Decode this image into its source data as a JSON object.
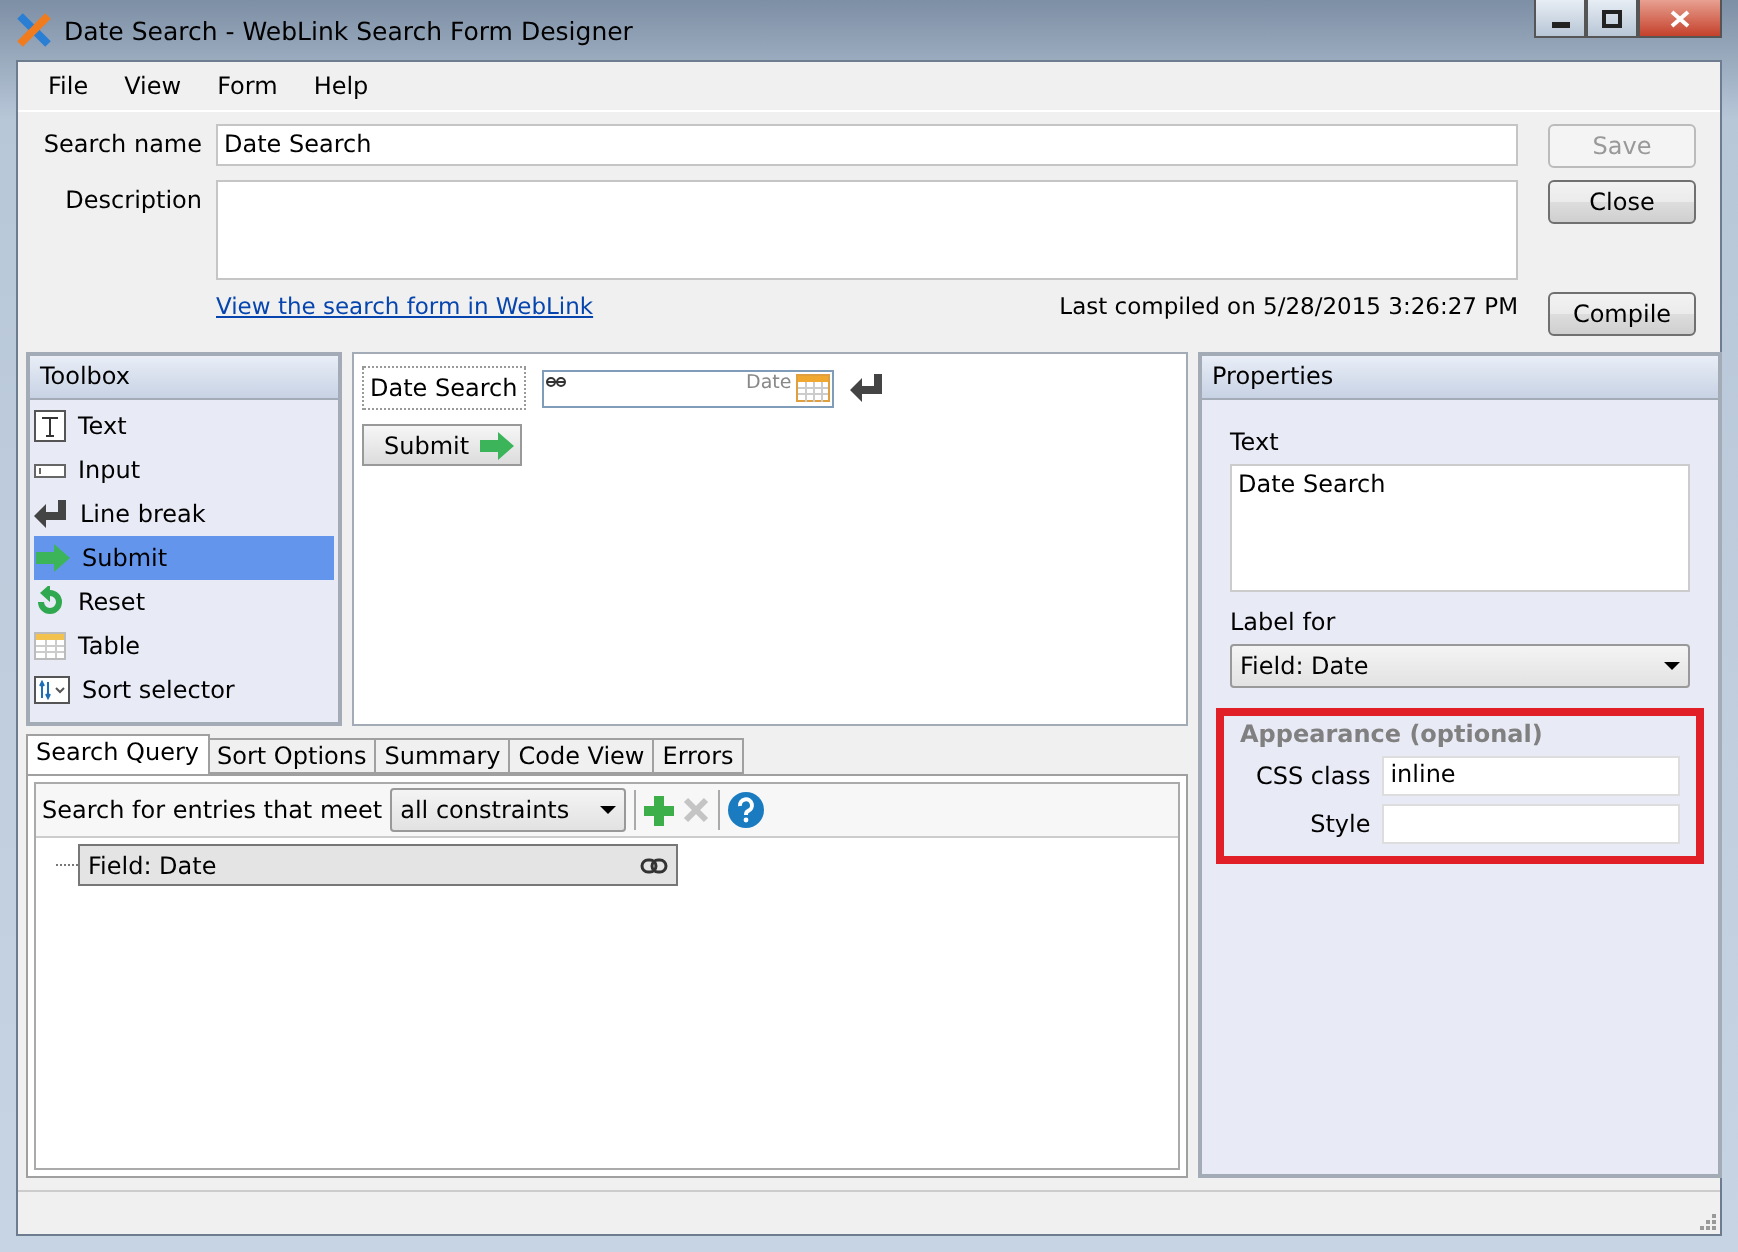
{
  "window": {
    "title": "Date Search - WebLink Search Form Designer"
  },
  "menu": [
    "File",
    "View",
    "Form",
    "Help"
  ],
  "search_name": {
    "label": "Search name",
    "value": "Date Search"
  },
  "description": {
    "label": "Description"
  },
  "link": "View the search form in WebLink",
  "last_compiled": "Last compiled on 5/28/2015 3:26:27 PM",
  "buttons": [
    {
      "label": "Save",
      "disabled": true
    },
    {
      "label": "Close",
      "disabled": false
    },
    {
      "label": "Compile",
      "disabled": false
    }
  ],
  "toolbox": {
    "title": "Toolbox",
    "items": [
      {
        "label": "Text",
        "kind": "text",
        "selected": false
      },
      {
        "label": "Input",
        "kind": "input",
        "selected": false
      },
      {
        "label": "Line break",
        "kind": "linebreak",
        "selected": false
      },
      {
        "label": "Submit",
        "kind": "submit",
        "selected": true
      },
      {
        "label": "Reset",
        "kind": "reset",
        "selected": false
      },
      {
        "label": "Table",
        "kind": "table",
        "selected": false
      },
      {
        "label": "Sort selector",
        "kind": "sort",
        "selected": false
      }
    ]
  },
  "canvas": {
    "label": "Date Search",
    "date_placeholder": "Date",
    "submit": "Submit"
  },
  "tabs": [
    {
      "label": "Search Query",
      "selected": true
    },
    {
      "label": "Sort Options",
      "selected": false
    },
    {
      "label": "Summary",
      "selected": false
    },
    {
      "label": "Code View",
      "selected": false
    },
    {
      "label": "Errors",
      "selected": false
    }
  ],
  "query": {
    "label": "Search for entries that meet",
    "match": "all constraints",
    "nodes": [
      "Field: Date"
    ]
  },
  "properties": {
    "title": "Properties",
    "text_label": "Text",
    "text_value": "Date Search",
    "label_for_label": "Label for",
    "label_for_value": "Field: Date",
    "appearance": {
      "title": "Appearance (optional)",
      "highlighted": true,
      "css_class": {
        "label": "CSS class",
        "value": "inline"
      },
      "style": {
        "label": "Style"
      }
    }
  }
}
